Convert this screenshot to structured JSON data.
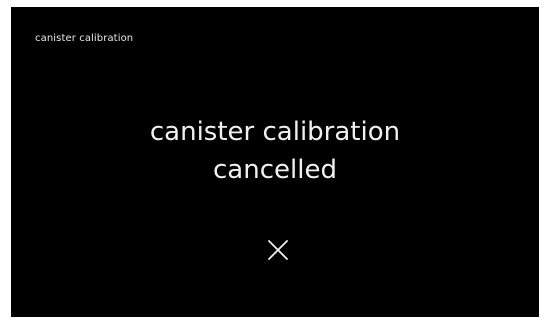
{
  "header": {
    "title": "canister calibration"
  },
  "message": {
    "line1": "canister calibration",
    "line2": "cancelled"
  },
  "icons": {
    "close": "close-icon"
  },
  "colors": {
    "background": "#000000",
    "text": "#f0f0f0"
  }
}
